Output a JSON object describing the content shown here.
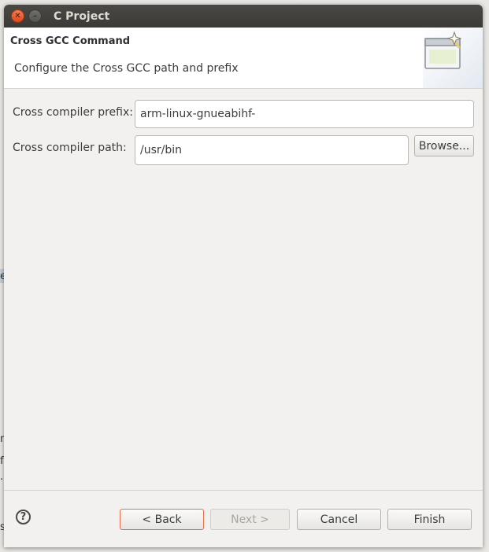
{
  "window": {
    "title": "C Project"
  },
  "header": {
    "title": "Cross GCC Command",
    "description": "Configure the Cross GCC path and prefix",
    "icon": "wizard-banner-icon"
  },
  "form": {
    "prefix_label": "Cross compiler prefix:",
    "prefix_value": "arm-linux-gnueabihf-",
    "path_label": "Cross compiler path:",
    "path_value": "/usr/bin",
    "browse_label": "Browse..."
  },
  "footer": {
    "help_glyph": "?",
    "back_label": "< Back",
    "next_label": "Next >",
    "cancel_label": "Cancel",
    "finish_label": "Finish"
  },
  "colors": {
    "titlebar": "#3c3b37",
    "close_button": "#e9541f",
    "focus_border": "#e96e49",
    "dialog_bg": "#f2f1f0"
  }
}
